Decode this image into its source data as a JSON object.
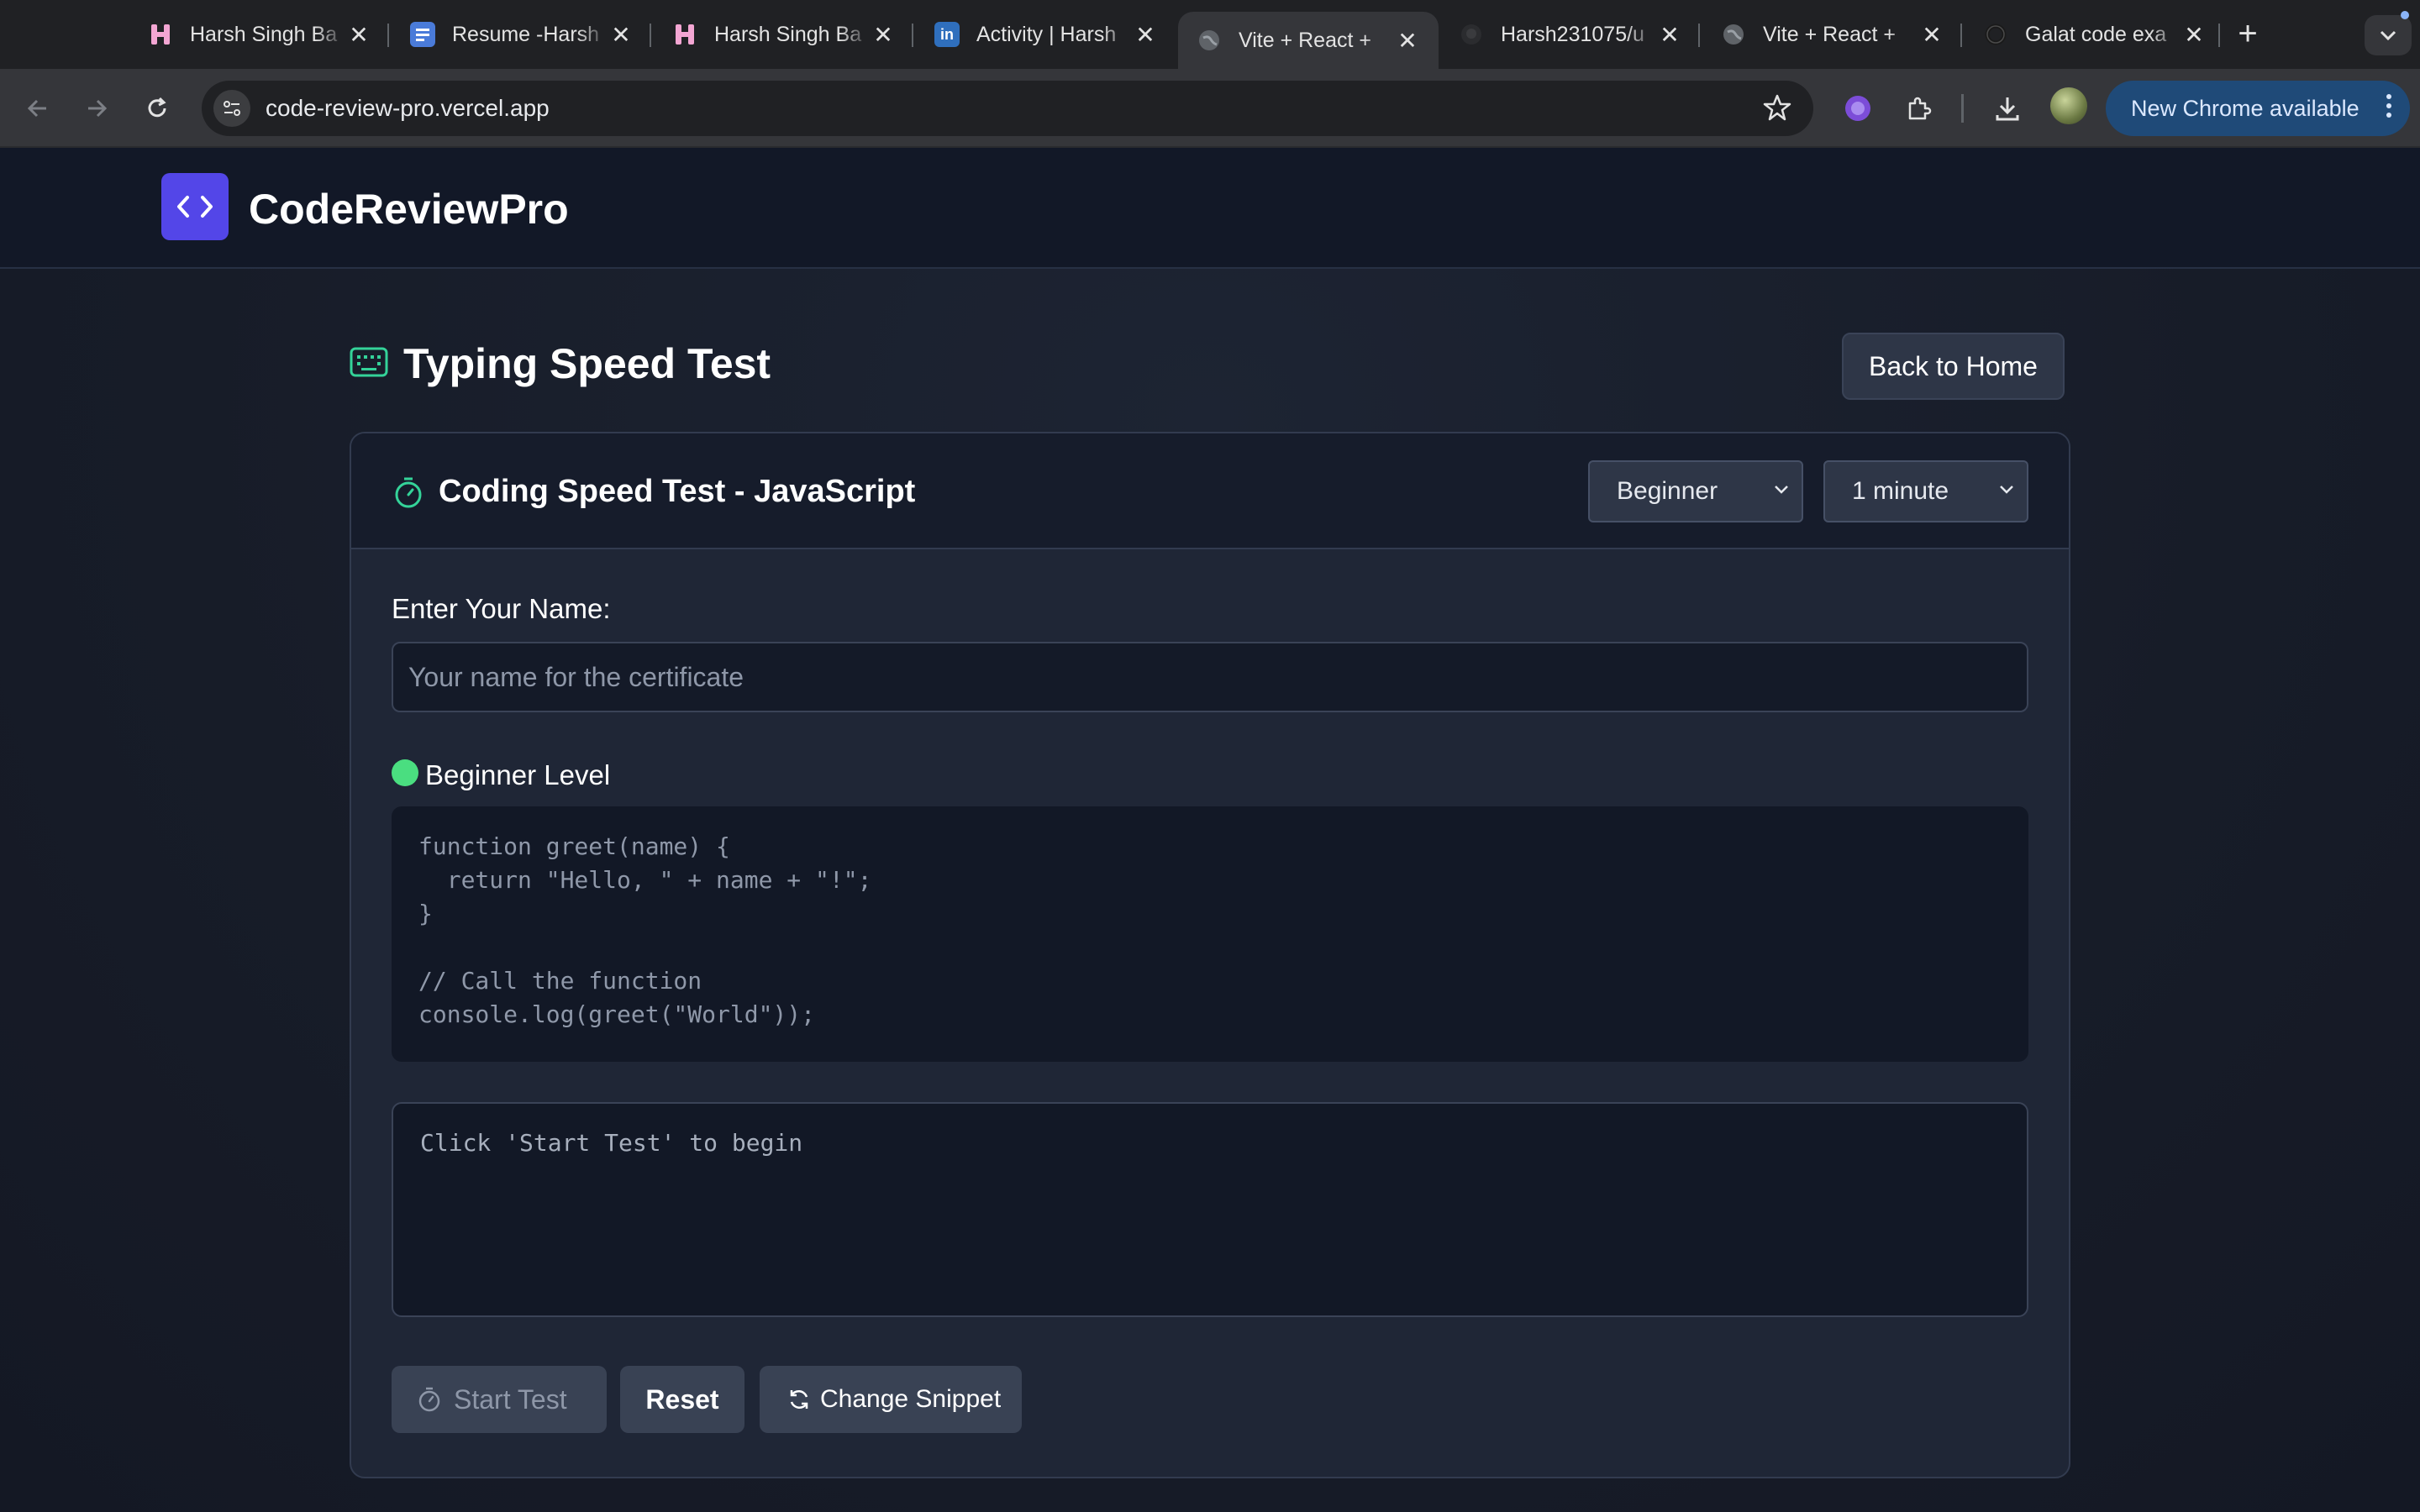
{
  "browser": {
    "tabs": [
      {
        "title": "Harsh Singh Ba",
        "favicon": "hashnode-icon",
        "active": false
      },
      {
        "title": "Resume -Harsh",
        "favicon": "docs-icon",
        "active": false
      },
      {
        "title": "Harsh Singh Ba",
        "favicon": "hashnode-icon",
        "active": false
      },
      {
        "title": "Activity | Harsh",
        "favicon": "linkedin-icon",
        "active": false
      },
      {
        "title": "Vite + React +",
        "favicon": "globe-icon",
        "active": true
      },
      {
        "title": "Harsh231075/u",
        "favicon": "github-icon",
        "active": false
      },
      {
        "title": "Vite + React +",
        "favicon": "globe-icon",
        "active": false
      },
      {
        "title": "Galat code exa",
        "favicon": "openai-icon",
        "active": false
      }
    ],
    "url": "code-review-pro.vercel.app",
    "update_button": "New Chrome available",
    "linkedin_favicon_text": "in"
  },
  "app": {
    "brand": "CodeReviewPro",
    "page_title": "Typing Speed Test",
    "back_button": "Back to Home",
    "card_title": "Coding Speed Test - JavaScript",
    "difficulty": {
      "selected": "Beginner"
    },
    "duration": {
      "selected": "1 minute"
    },
    "name_label": "Enter Your Name:",
    "name_placeholder": "Your name for the certificate",
    "level_label": "Beginner Level",
    "code_snippet": "function greet(name) {\n  return \"Hello, \" + name + \"!\";\n}\n\n// Call the function\nconsole.log(greet(\"World\"));",
    "typing_placeholder": "Click 'Start Test' to begin",
    "buttons": {
      "start": "Start Test",
      "reset": "Reset",
      "change_snippet": "Change Snippet"
    }
  },
  "colors": {
    "accent": "#5346e8",
    "level_dot": "#4ade80",
    "icon_teal": "#34d399",
    "update_pill": "#1f4a78"
  }
}
